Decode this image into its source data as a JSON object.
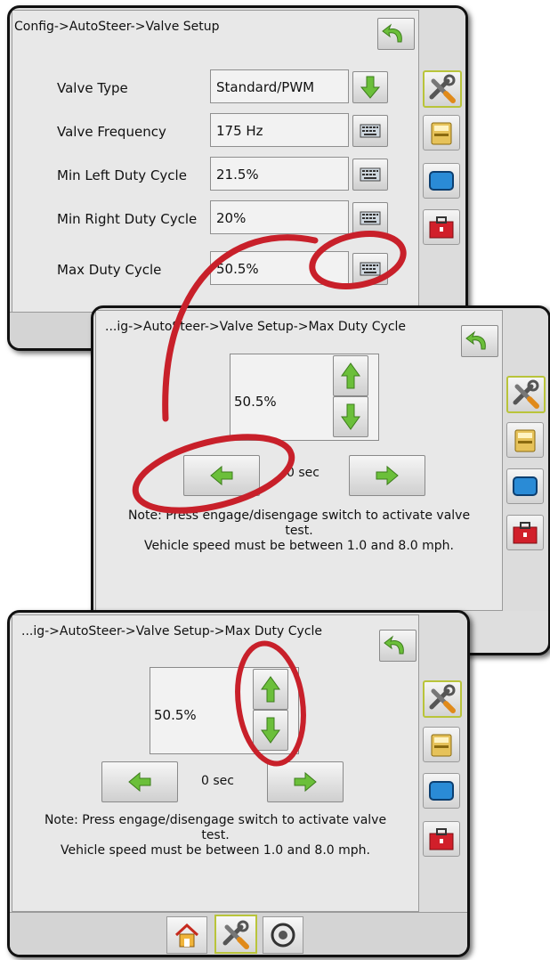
{
  "screen1": {
    "title": "Config->AutoSteer->Valve Setup",
    "rows": [
      {
        "label": "Valve Type",
        "value": "Standard/PWM",
        "control": "down-arrow"
      },
      {
        "label": "Valve Frequency",
        "value": "175 Hz",
        "control": "keyboard"
      },
      {
        "label": "Min Left Duty Cycle",
        "value": "21.5%",
        "control": "keyboard"
      },
      {
        "label": "Min Right Duty Cycle",
        "value": "20%",
        "control": "keyboard"
      },
      {
        "label": "Max Duty Cycle",
        "value": "50.5%",
        "control": "keyboard"
      }
    ]
  },
  "screen2": {
    "title": "...ig->AutoSteer->Valve Setup->Max Duty Cycle",
    "value": "50.5%",
    "time": "0 sec",
    "note_line1": "Note: Press engage/disengage switch to activate valve",
    "note_line2": "test.",
    "note_line3": "Vehicle speed must be between 1.0 and 8.0 mph."
  },
  "screen3": {
    "title": "...ig->AutoSteer->Valve Setup->Max Duty Cycle",
    "value": "50.5%",
    "time": "0 sec",
    "note_line1": "Note: Press engage/disengage switch to activate valve",
    "note_line2": "test.",
    "note_line3": "Vehicle speed must be between 1.0 and 8.0 mph."
  },
  "sidebar_icons": [
    "tools-icon",
    "console-icon",
    "display-icon",
    "toolbox-icon"
  ],
  "bottom_nav": [
    "home-icon",
    "tools-icon",
    "gauge-icon"
  ],
  "colors": {
    "arrow_green": "#6bbf3a",
    "highlight_red": "#c8202a",
    "active_border": "#b9c43a"
  }
}
